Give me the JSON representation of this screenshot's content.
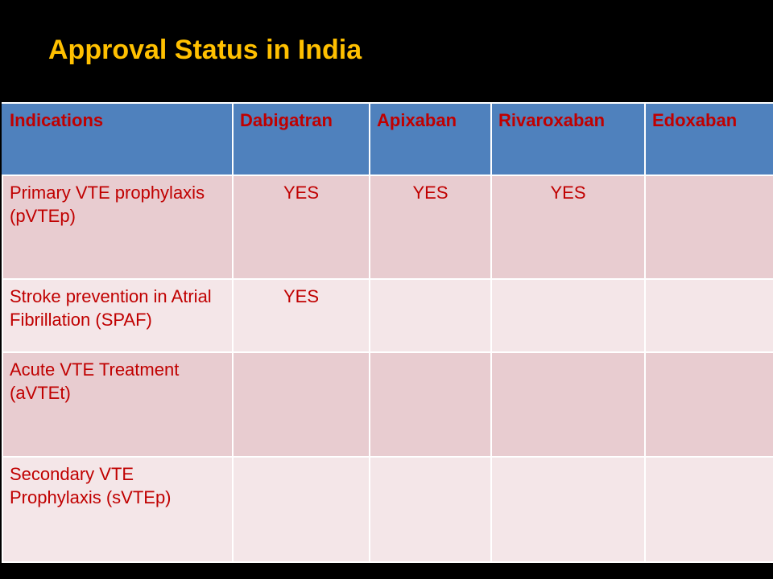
{
  "slide": {
    "title": "Approval Status in India"
  },
  "table": {
    "headers": [
      "Indications",
      "Dabigatran",
      "Apixaban",
      "Rivaroxaban",
      "Edoxaban"
    ],
    "rows": [
      {
        "indication": "Primary VTE prophylaxis (pVTEp)",
        "values": [
          "YES",
          "YES",
          "YES",
          ""
        ]
      },
      {
        "indication": "Stroke prevention in Atrial Fibrillation (SPAF)",
        "values": [
          "YES",
          "",
          "",
          ""
        ]
      },
      {
        "indication": "Acute VTE Treatment (aVTEt)",
        "values": [
          "",
          "",
          "",
          ""
        ]
      },
      {
        "indication": "Secondary VTE Prophylaxis (sVTEp)",
        "values": [
          "",
          "",
          "",
          ""
        ]
      }
    ]
  },
  "colors": {
    "background": "#000000",
    "title": "#ffc000",
    "header_fill": "#4f81bd",
    "cell_text": "#c00000",
    "row_dark": "#e8ccd0",
    "row_light": "#f4e6e8"
  }
}
